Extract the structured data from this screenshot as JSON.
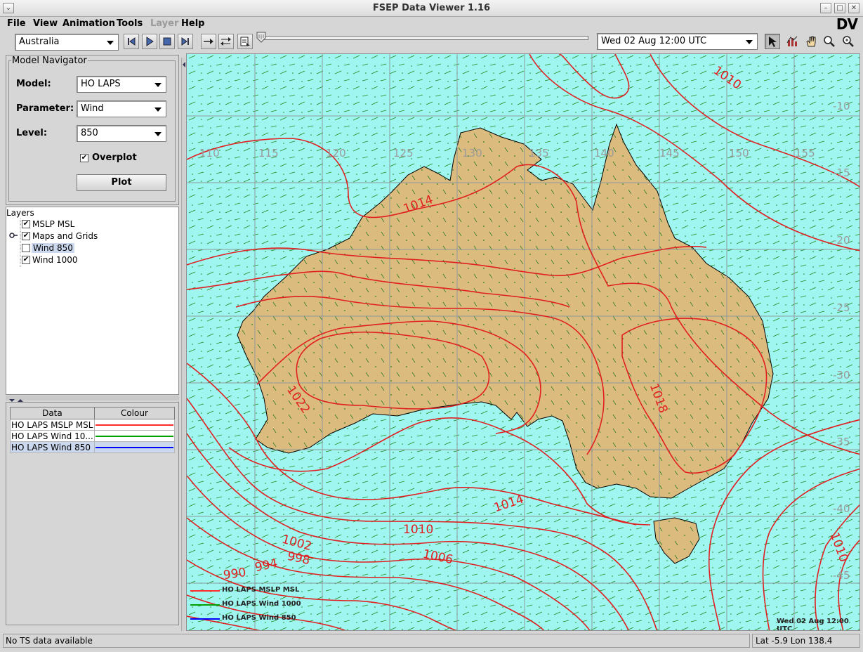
{
  "window": {
    "title": "FSEP Data Viewer 1.16",
    "logo": "DV"
  },
  "menubar": {
    "items": [
      {
        "label": "File",
        "enabled": true
      },
      {
        "label": "View",
        "enabled": true
      },
      {
        "label": "Animation",
        "enabled": true
      },
      {
        "label": "Tools",
        "enabled": true
      },
      {
        "label": "Layer",
        "enabled": false
      },
      {
        "label": "Help",
        "enabled": true
      }
    ]
  },
  "toolbar": {
    "region": "Australia",
    "datetime": "Wed 02 Aug 12:00 UTC",
    "slider_value": 0,
    "animation_buttons": [
      "step-back-icon",
      "play-icon",
      "stop-icon",
      "step-forward-icon"
    ],
    "mode_buttons": [
      "loop-forward-icon",
      "loop-swap-icon",
      "frames-icon"
    ],
    "tool_buttons": [
      {
        "icon": "pointer-icon",
        "pressed": true
      },
      {
        "icon": "chart-icon",
        "pressed": false
      },
      {
        "icon": "pan-hand-icon",
        "pressed": false
      },
      {
        "icon": "zoom-out-icon",
        "pressed": false
      },
      {
        "icon": "zoom-in-icon",
        "pressed": false
      }
    ]
  },
  "model_navigator": {
    "title": "Model Navigator",
    "model_label": "Model:",
    "model_value": "HO LAPS",
    "parameter_label": "Parameter:",
    "parameter_value": "Wind",
    "level_label": "Level:",
    "level_value": "850",
    "overplot_label": "Overplot",
    "overplot_checked": true,
    "plot_button": "Plot"
  },
  "layers": {
    "title": "Layers",
    "items": [
      {
        "label": "MSLP MSL",
        "checked": true,
        "selected": false
      },
      {
        "label": "Maps and Grids",
        "checked": true,
        "selected": false
      },
      {
        "label": "Wind  850",
        "checked": false,
        "selected": true
      },
      {
        "label": "Wind 1000",
        "checked": true,
        "selected": false
      }
    ]
  },
  "data_legend": {
    "headers": [
      "Data",
      "Colour"
    ],
    "rows": [
      {
        "name": "HO LAPS MSLP MSL",
        "color": "#ff2a2a",
        "selected": false
      },
      {
        "name": "HO LAPS Wind 10...",
        "color": "#00a000",
        "selected": false
      },
      {
        "name": "HO LAPS Wind  850",
        "color": "#0000ff",
        "selected": true
      }
    ]
  },
  "map": {
    "lon_labels": [
      "110",
      "115",
      "120",
      "125",
      "130",
      "135",
      "140",
      "145",
      "150",
      "155"
    ],
    "lat_labels": [
      "-10",
      "-15",
      "-20",
      "-25",
      "-30",
      "-35",
      "-40",
      "-45"
    ],
    "isobar_labels": [
      "1010",
      "1014",
      "1022",
      "1018",
      "1014",
      "1010",
      "1002",
      "998",
      "994",
      "990",
      "1006",
      "1010"
    ],
    "legend": [
      {
        "label": "HO LAPS MSLP MSL",
        "color": "#ff2a2a"
      },
      {
        "label": "HO LAPS Wind 1000",
        "color": "#00a000"
      },
      {
        "label": "HO LAPS Wind  850",
        "color": "#0000ff"
      }
    ],
    "timestamp": "Wed 02 Aug 12:00 UTC",
    "ocean_color": "#9ff5f0",
    "land_color": "#dcbc7e",
    "isobar_color": "#e02020"
  },
  "status": {
    "message": "No TS data available",
    "coords": "Lat -5.9  Lon 138.4"
  }
}
